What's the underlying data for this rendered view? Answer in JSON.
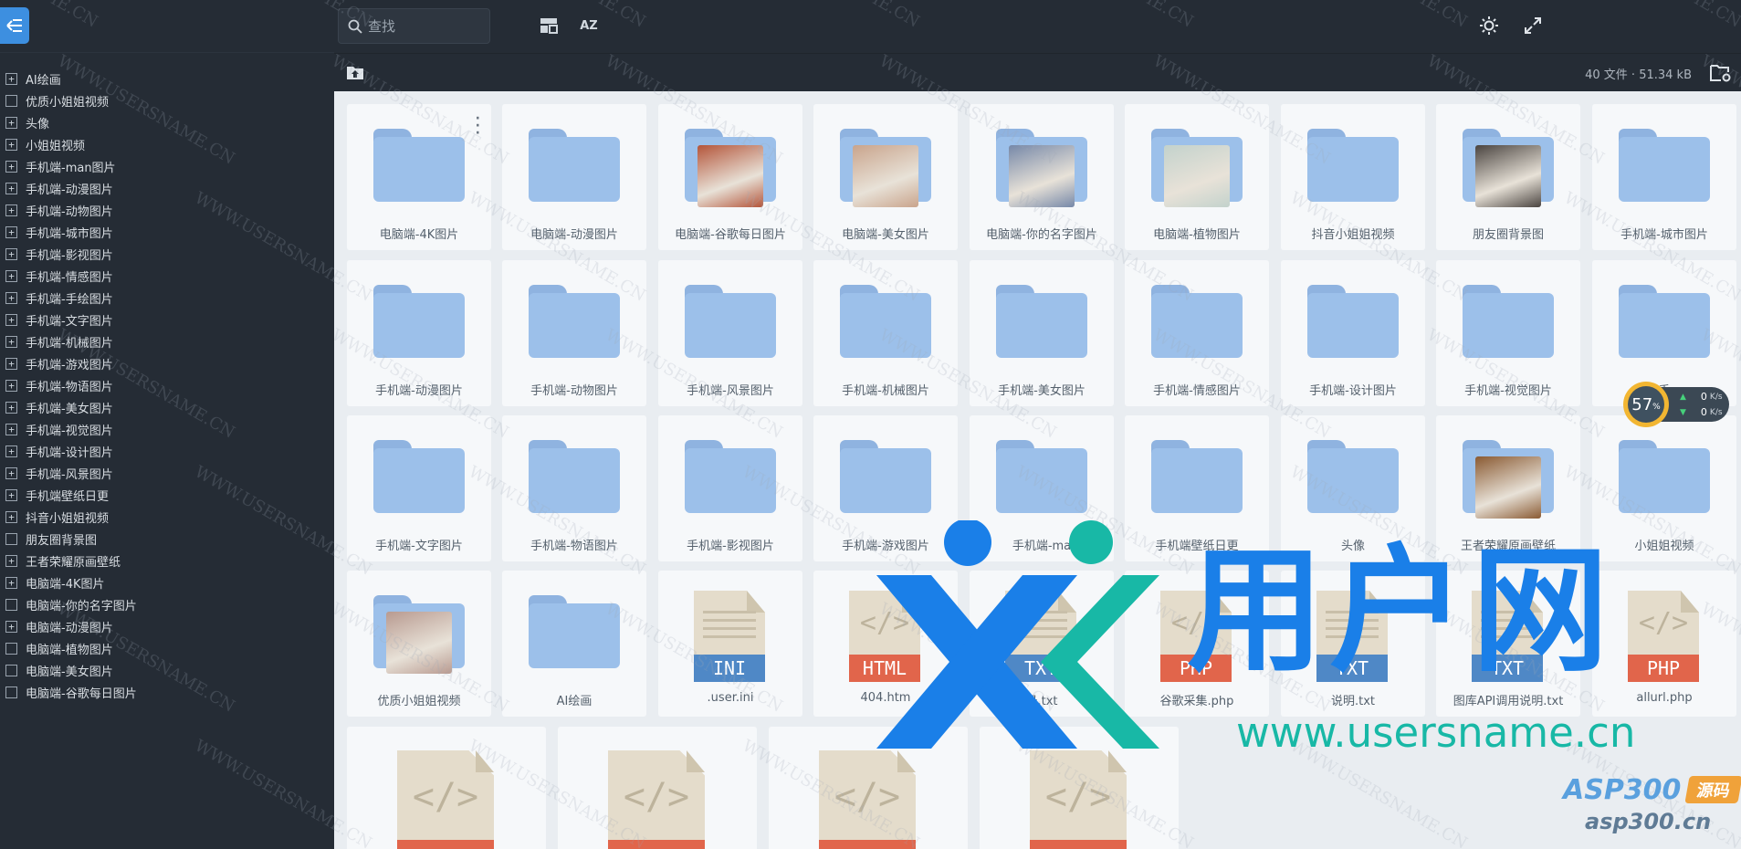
{
  "topbar": {
    "search_placeholder": "查找",
    "sort_label": "AZ",
    "file_info": "40 文件 · 51.34 kB"
  },
  "sidebar": {
    "items": [
      {
        "label": "AI绘画",
        "expandable": true
      },
      {
        "label": "优质小姐姐视频",
        "expandable": false
      },
      {
        "label": "头像",
        "expandable": true
      },
      {
        "label": "小姐姐视频",
        "expandable": true
      },
      {
        "label": "手机端-man图片",
        "expandable": true
      },
      {
        "label": "手机端-动漫图片",
        "expandable": true
      },
      {
        "label": "手机端-动物图片",
        "expandable": true
      },
      {
        "label": "手机端-城市图片",
        "expandable": true
      },
      {
        "label": "手机端-影视图片",
        "expandable": true
      },
      {
        "label": "手机端-情感图片",
        "expandable": true
      },
      {
        "label": "手机端-手绘图片",
        "expandable": true
      },
      {
        "label": "手机端-文字图片",
        "expandable": true
      },
      {
        "label": "手机端-机械图片",
        "expandable": true
      },
      {
        "label": "手机端-游戏图片",
        "expandable": true
      },
      {
        "label": "手机端-物语图片",
        "expandable": true
      },
      {
        "label": "手机端-美女图片",
        "expandable": true
      },
      {
        "label": "手机端-视觉图片",
        "expandable": true
      },
      {
        "label": "手机端-设计图片",
        "expandable": true
      },
      {
        "label": "手机端-风景图片",
        "expandable": true
      },
      {
        "label": "手机端壁纸日更",
        "expandable": true
      },
      {
        "label": "抖音小姐姐视频",
        "expandable": true
      },
      {
        "label": "朋友圈背景图",
        "expandable": false
      },
      {
        "label": "王者荣耀原画壁纸",
        "expandable": true
      },
      {
        "label": "电脑端-4K图片",
        "expandable": true
      },
      {
        "label": "电脑端-你的名字图片",
        "expandable": false
      },
      {
        "label": "电脑端-动漫图片",
        "expandable": true
      },
      {
        "label": "电脑端-植物图片",
        "expandable": false
      },
      {
        "label": "电脑端-美女图片",
        "expandable": false
      },
      {
        "label": "电脑端-谷歌每日图片",
        "expandable": false
      }
    ]
  },
  "grid": {
    "rows": [
      [
        {
          "name": "电脑端-4K图片",
          "kind": "folder"
        },
        {
          "name": "电脑端-动漫图片",
          "kind": "folder"
        },
        {
          "name": "电脑端-谷歌每日图片",
          "kind": "folder",
          "thumb": "#b4553a"
        },
        {
          "name": "电脑端-美女图片",
          "kind": "folder",
          "thumb": "#c9a48c"
        },
        {
          "name": "电脑端-你的名字图片",
          "kind": "folder",
          "thumb": "#7688a8"
        },
        {
          "name": "电脑端-植物图片",
          "kind": "folder",
          "thumb": "#c3d2cc"
        },
        {
          "name": "抖音小姐姐视频",
          "kind": "folder"
        },
        {
          "name": "朋友圈背景图",
          "kind": "folder",
          "thumb": "#4a4440"
        },
        {
          "name": "手机端-城市图片",
          "kind": "folder"
        }
      ],
      [
        {
          "name": "手机端-动漫图片",
          "kind": "folder"
        },
        {
          "name": "手机端-动物图片",
          "kind": "folder"
        },
        {
          "name": "手机端-风景图片",
          "kind": "folder"
        },
        {
          "name": "手机端-机械图片",
          "kind": "folder"
        },
        {
          "name": "手机端-美女图片",
          "kind": "folder"
        },
        {
          "name": "手机端-情感图片",
          "kind": "folder"
        },
        {
          "name": "手机端-设计图片",
          "kind": "folder"
        },
        {
          "name": "手机端-视觉图片",
          "kind": "folder"
        },
        {
          "name": "手",
          "kind": "folder"
        }
      ],
      [
        {
          "name": "手机端-文字图片",
          "kind": "folder"
        },
        {
          "name": "手机端-物语图片",
          "kind": "folder"
        },
        {
          "name": "手机端-影视图片",
          "kind": "folder"
        },
        {
          "name": "手机端-游戏图片",
          "kind": "folder"
        },
        {
          "name": "手机端-ma",
          "kind": "folder"
        },
        {
          "name": "手机端壁纸日更",
          "kind": "folder"
        },
        {
          "name": "头像",
          "kind": "folder"
        },
        {
          "name": "王者荣耀原画壁纸",
          "kind": "folder",
          "thumb": "#8a5a32"
        },
        {
          "name": "小姐姐视频",
          "kind": "folder"
        }
      ],
      [
        {
          "name": "优质小姐姐视频",
          "kind": "folder",
          "thumb": "#b89a90"
        },
        {
          "name": "AI绘画",
          "kind": "folder"
        },
        {
          "name": ".user.ini",
          "kind": "file",
          "ext": "INI",
          "color": "#4f88c6"
        },
        {
          "name": "404.htm",
          "kind": "file",
          "ext": "HTML",
          "color": "#e1654b"
        },
        {
          "name": "录.txt",
          "kind": "file",
          "ext": "TXT",
          "color": "#4f88c6"
        },
        {
          "name": "谷歌采集.php",
          "kind": "file",
          "ext": "PHP",
          "color": "#e1654b"
        },
        {
          "name": "说明.txt",
          "kind": "file",
          "ext": "TXT",
          "color": "#4f88c6"
        },
        {
          "name": "图库API调用说明.txt",
          "kind": "file",
          "ext": "TXT",
          "color": "#4f88c6"
        },
        {
          "name": "allurl.php",
          "kind": "file",
          "ext": "PHP",
          "color": "#e1654b"
        }
      ]
    ],
    "bottom_row_count": 4
  },
  "speed": {
    "percent": "57",
    "unit": "%",
    "up": "0",
    "down": "0",
    "rate_unit": "K/s"
  },
  "watermark": {
    "text": "WWW.USERSNAME.CN",
    "brand_cn": "用户网",
    "brand_url": "www.usersname.cn",
    "brand2": "ASP300",
    "brand2_cn": "源码",
    "brand2_url": "asp300.cn"
  },
  "colors": {
    "accent": "#3d8fe0",
    "sidebar_bg": "#252c35",
    "folder": "#9cc0ea",
    "logo_blue": "#1a7fe8",
    "logo_teal": "#18b8a6"
  }
}
